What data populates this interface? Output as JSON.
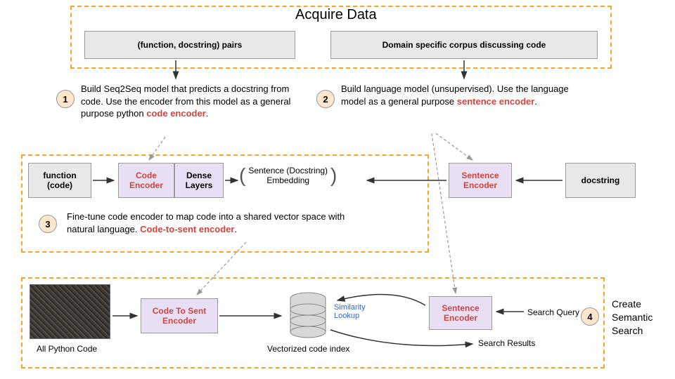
{
  "title": "Acquire Data",
  "topBoxes": {
    "left": "(function, docstring) pairs",
    "right": "Domain specific corpus discussing code"
  },
  "step1": {
    "num": "1",
    "text": "Build Seq2Seq model that predicts a docstring from code. Use the encoder from this model as a general purpose python ",
    "highlight": "code encoder",
    "suffix": "."
  },
  "step2": {
    "num": "2",
    "text": "Build language model (unsupervised).  Use the language model as a general purpose ",
    "highlight": "sentence encoder",
    "suffix": "."
  },
  "midRow": {
    "funcCode": "function\n(code)",
    "codeEncoder": "Code\nEncoder",
    "denseLayers": "Dense\nLayers",
    "embedding": "Sentence (Docstring)\nEmbedding",
    "sentenceEncoder": "Sentence\nEncoder",
    "docstring": "docstring"
  },
  "step3": {
    "num": "3",
    "text": "Fine-tune code encoder to map code into a shared vector space with natural language.  ",
    "highlight": "Code-to-sent encoder",
    "suffix": "."
  },
  "bottom": {
    "allPython": "All Python Code",
    "codeToSent": "Code To Sent\nEncoder",
    "vecIndex": "Vectorized code index",
    "similarity": "Similarity\nLookup",
    "sentenceEncoder": "Sentence\nEncoder",
    "searchQuery": "Search Query",
    "searchResults": "Search Results",
    "step4num": "4",
    "step4text": "Create\nSemantic\nSearch"
  }
}
